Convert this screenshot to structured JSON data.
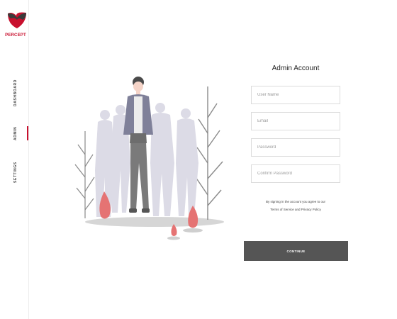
{
  "brand": {
    "name": "PERCEPT",
    "logo_icon": "percept-logo-icon",
    "accent": "#c8102e"
  },
  "sidebar": {
    "items": [
      {
        "label": "DASHBOARD",
        "active": false
      },
      {
        "label": "ADMIN",
        "active": true
      },
      {
        "label": "SETTINGS",
        "active": false
      }
    ]
  },
  "illustration": {
    "icon": "team-people-illustration",
    "accent": "#e46a6a"
  },
  "form": {
    "title": "Admin Account",
    "fields": {
      "user_name": {
        "placeholder": "User Name",
        "value": ""
      },
      "email": {
        "placeholder": "Email",
        "value": ""
      },
      "password": {
        "placeholder": "Password",
        "value": ""
      },
      "confirm_password": {
        "placeholder": "Confirm Password",
        "value": ""
      }
    },
    "terms_line1": "By signing in the account you agree to our",
    "terms_line2": "Terms of Service and Privacy Policy",
    "submit_label": "CONTINUE",
    "submit_color": "#555555"
  }
}
